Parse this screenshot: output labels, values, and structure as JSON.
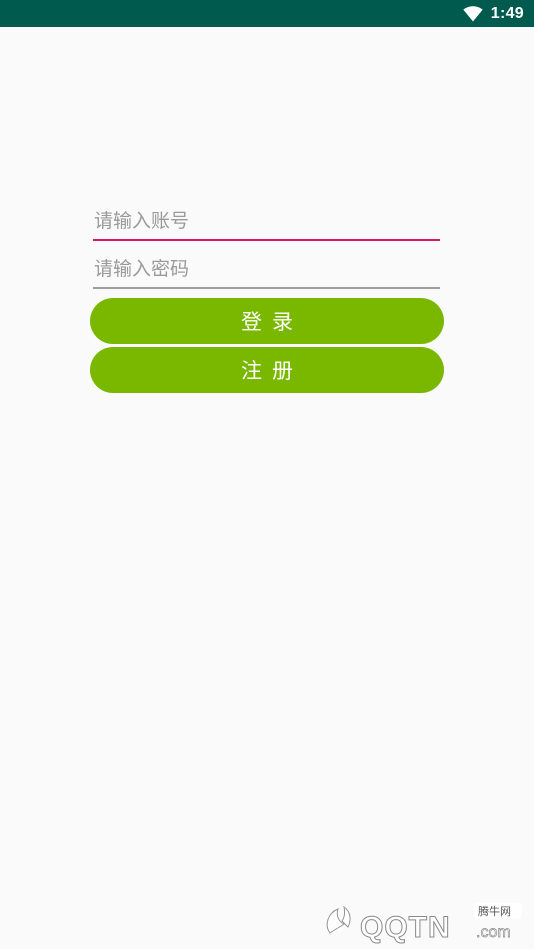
{
  "status_bar": {
    "time": "1:49",
    "wifi_icon": "wifi-icon",
    "background": "#005a4e"
  },
  "login_form": {
    "account_placeholder": "请输入账号",
    "account_value": "",
    "password_placeholder": "请输入密码",
    "password_value": "",
    "login_label": "登录",
    "register_label": "注册",
    "accent_color": "#d81b60",
    "button_color": "#7ab800"
  },
  "watermark": {
    "logo_text": "QQTN",
    "domain_suffix": ".com",
    "badge_text": "腾牛网"
  }
}
